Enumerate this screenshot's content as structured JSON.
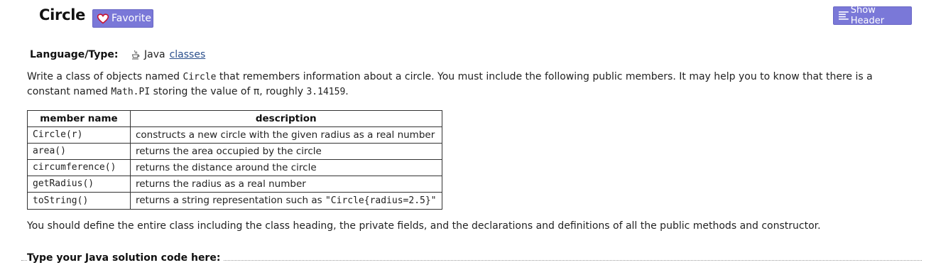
{
  "header": {
    "title": "Circle",
    "favorite_label": "Favorite",
    "show_header_label": "Show Header"
  },
  "meta": {
    "language_label": "Language/Type:",
    "language_value": "Java",
    "type_link": "classes"
  },
  "description": {
    "p1_a": "Write a class of objects named ",
    "p1_code1": "Circle",
    "p1_b": " that remembers information about a circle. You must include the following public members. It may help you to know that there is a constant named ",
    "p1_code2": "Math.PI",
    "p1_c": " storing the value of π, roughly ",
    "p1_code3": "3.14159",
    "p1_d": "."
  },
  "members_table": {
    "headers": [
      "member name",
      "description"
    ],
    "rows": [
      {
        "name": "Circle(r)",
        "description": "constructs a new circle with the given radius as a real number"
      },
      {
        "name": "area()",
        "description": "returns the area occupied by the circle"
      },
      {
        "name": "circumference()",
        "description": "returns the distance around the circle"
      },
      {
        "name": "getRadius()",
        "description": "returns the radius as a real number"
      },
      {
        "name": "toString()",
        "description_a": "returns a string representation such as ",
        "description_code": "\"Circle{radius=2.5}\""
      }
    ]
  },
  "footer": {
    "text": "You should define the entire class including the class heading, the private fields, and the declarations and definitions of all the public methods and constructor.",
    "code_legend": "Type your Java solution code here:"
  },
  "colors": {
    "button_bg": "#7a78d8",
    "link": "#2a4f8c",
    "heart": "#c8102e"
  },
  "icons": {
    "favorite": "heart-outline-icon",
    "show_header": "menu-lines-icon",
    "language": "java-cup-icon"
  }
}
